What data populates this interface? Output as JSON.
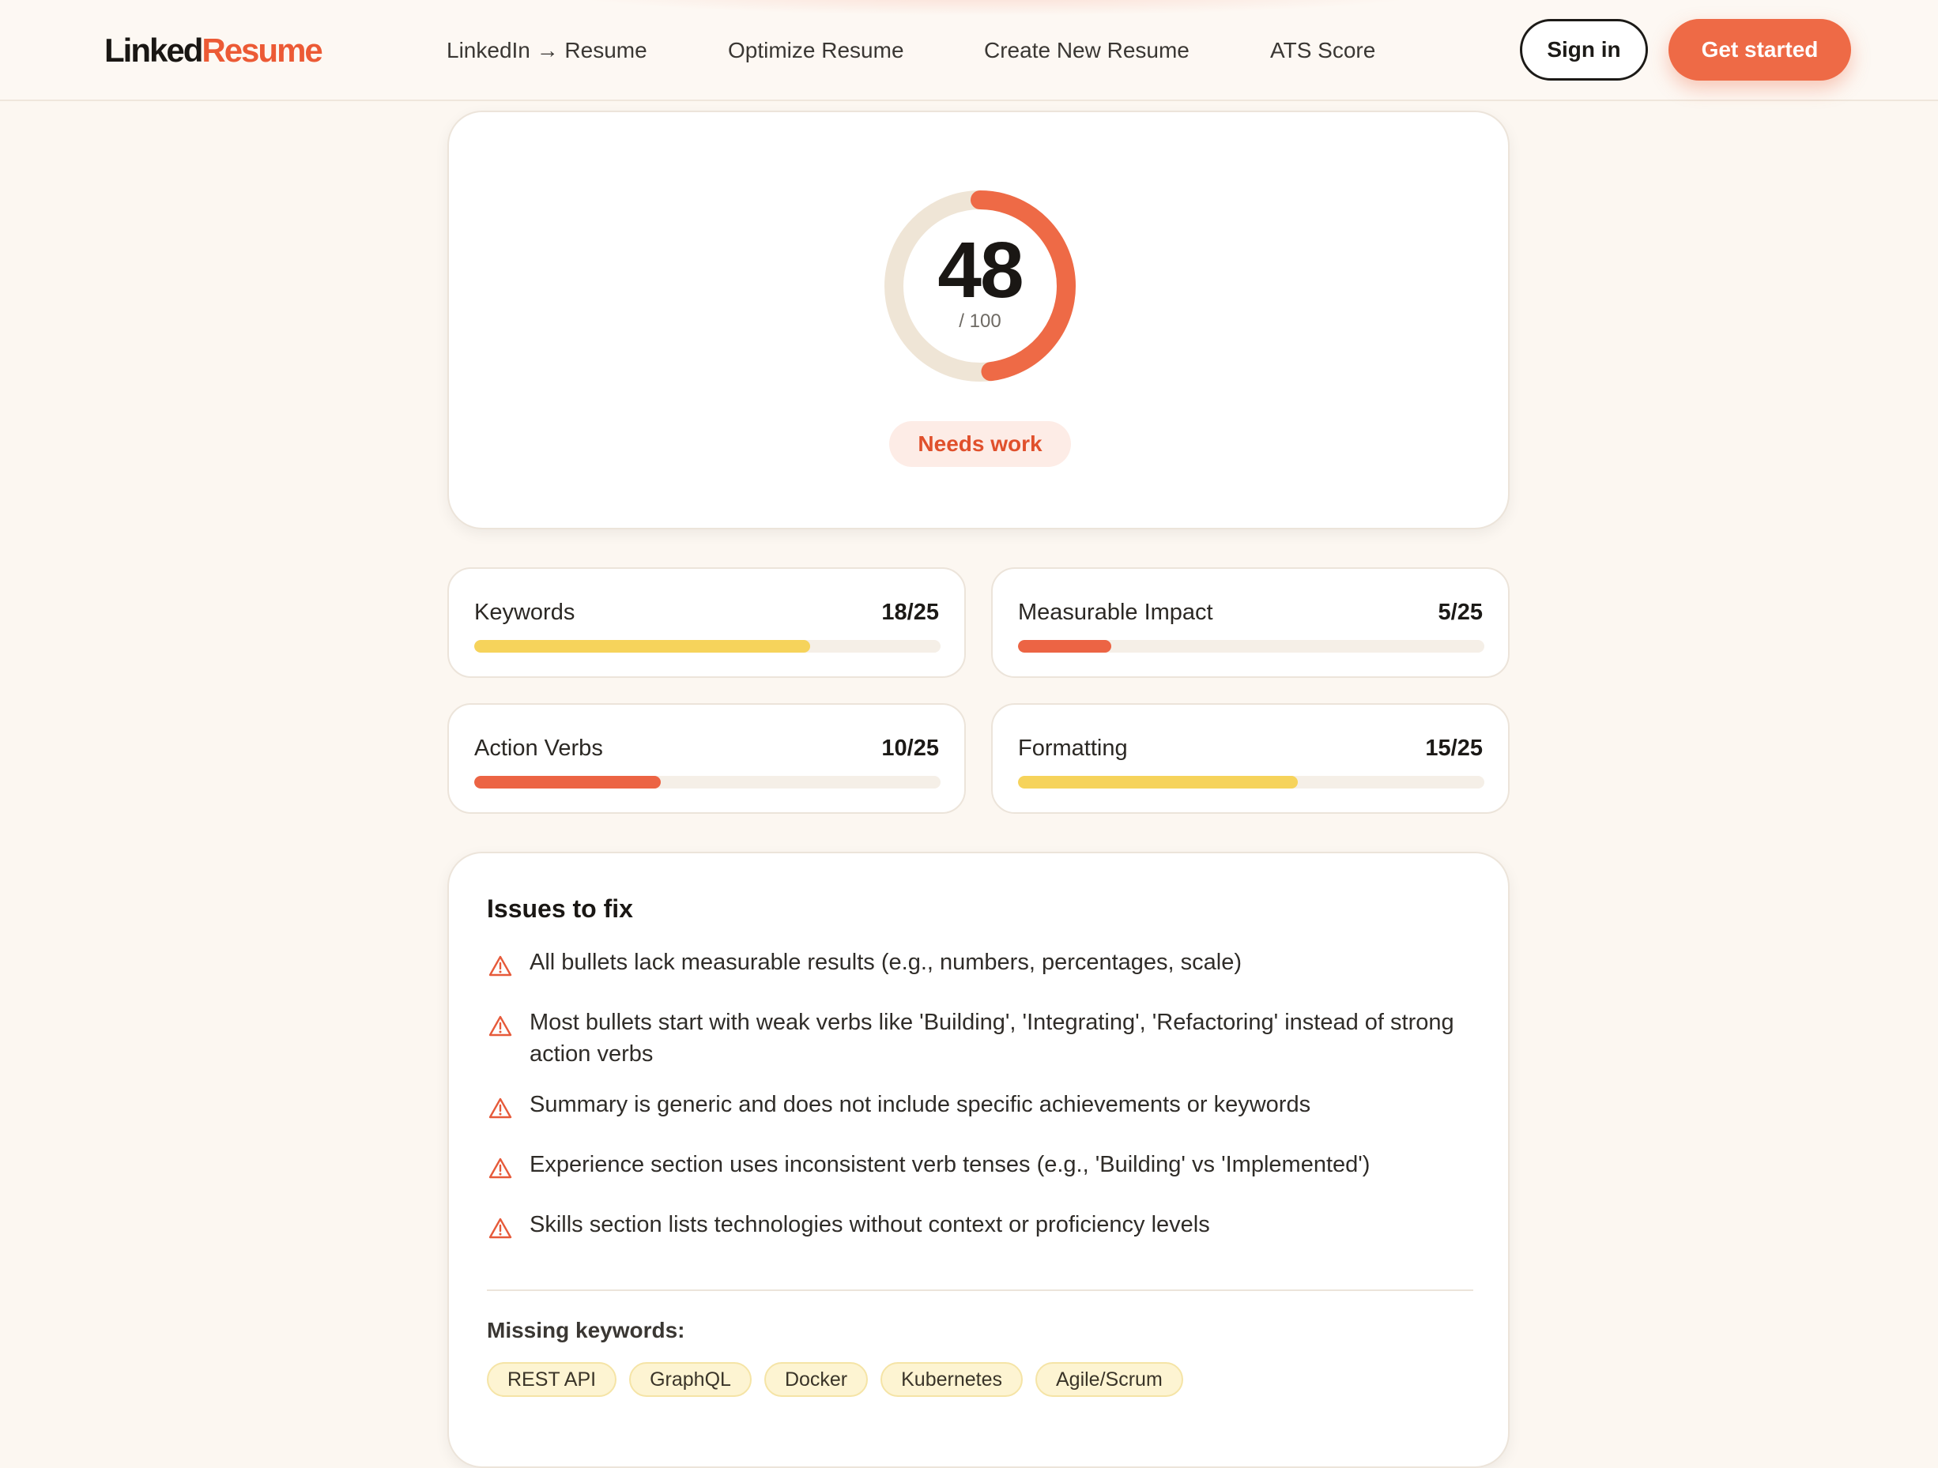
{
  "header": {
    "logo_part1": "Linked",
    "logo_part2": "Resume",
    "nav": [
      {
        "label": "LinkedIn → Resume"
      },
      {
        "label": "Optimize Resume"
      },
      {
        "label": "Create New Resume"
      },
      {
        "label": "ATS Score"
      }
    ],
    "signin_label": "Sign in",
    "get_started_label": "Get started"
  },
  "score": {
    "value": "48",
    "max_label": "/ 100",
    "fraction": 0.48,
    "status": "Needs work"
  },
  "metrics": [
    {
      "label": "Keywords",
      "value": "18/25",
      "fraction": 0.72,
      "color": "#f6d35b"
    },
    {
      "label": "Measurable Impact",
      "value": "5/25",
      "fraction": 0.2,
      "color": "#ec6444"
    },
    {
      "label": "Action Verbs",
      "value": "10/25",
      "fraction": 0.4,
      "color": "#ec6444"
    },
    {
      "label": "Formatting",
      "value": "15/25",
      "fraction": 0.6,
      "color": "#f6d35b"
    }
  ],
  "issues": {
    "title": "Issues to fix",
    "icon": "warning-triangle-icon",
    "items": [
      "All bullets lack measurable results (e.g., numbers, percentages, scale)",
      "Most bullets start with weak verbs like 'Building', 'Integrating', 'Refactoring' instead of strong action verbs",
      "Summary is generic and does not include specific achievements or keywords",
      "Experience section uses inconsistent verb tenses (e.g., 'Building' vs 'Implemented')",
      "Skills section lists technologies without context or proficiency levels"
    ],
    "missing_title": "Missing keywords:",
    "missing_keywords": [
      "REST API",
      "GraphQL",
      "Docker",
      "Kubernetes",
      "Agile/Scrum"
    ]
  },
  "colors": {
    "accent": "#ee6a46",
    "gauge_track": "#efe5d6",
    "warning": "#e65a3a",
    "yellow_bar": "#f6d35b"
  }
}
